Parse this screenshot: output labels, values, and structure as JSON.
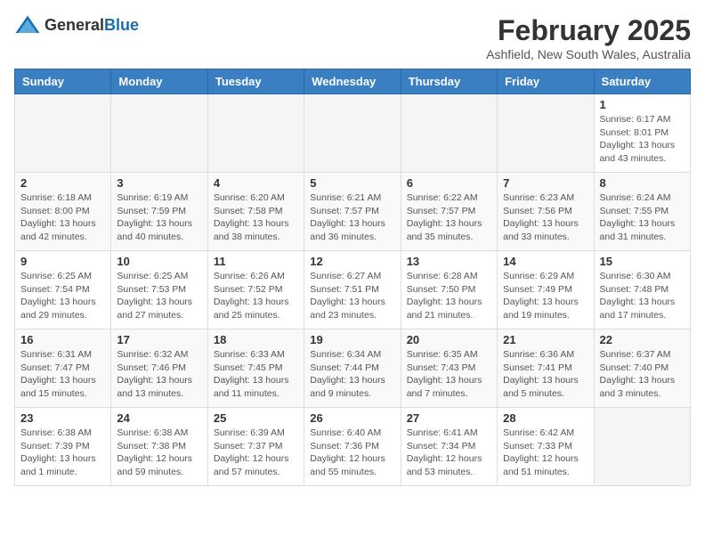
{
  "header": {
    "logo_general": "General",
    "logo_blue": "Blue",
    "title": "February 2025",
    "subtitle": "Ashfield, New South Wales, Australia"
  },
  "days_of_week": [
    "Sunday",
    "Monday",
    "Tuesday",
    "Wednesday",
    "Thursday",
    "Friday",
    "Saturday"
  ],
  "weeks": [
    [
      {
        "day": "",
        "info": ""
      },
      {
        "day": "",
        "info": ""
      },
      {
        "day": "",
        "info": ""
      },
      {
        "day": "",
        "info": ""
      },
      {
        "day": "",
        "info": ""
      },
      {
        "day": "",
        "info": ""
      },
      {
        "day": "1",
        "info": "Sunrise: 6:17 AM\nSunset: 8:01 PM\nDaylight: 13 hours and 43 minutes."
      }
    ],
    [
      {
        "day": "2",
        "info": "Sunrise: 6:18 AM\nSunset: 8:00 PM\nDaylight: 13 hours and 42 minutes."
      },
      {
        "day": "3",
        "info": "Sunrise: 6:19 AM\nSunset: 7:59 PM\nDaylight: 13 hours and 40 minutes."
      },
      {
        "day": "4",
        "info": "Sunrise: 6:20 AM\nSunset: 7:58 PM\nDaylight: 13 hours and 38 minutes."
      },
      {
        "day": "5",
        "info": "Sunrise: 6:21 AM\nSunset: 7:57 PM\nDaylight: 13 hours and 36 minutes."
      },
      {
        "day": "6",
        "info": "Sunrise: 6:22 AM\nSunset: 7:57 PM\nDaylight: 13 hours and 35 minutes."
      },
      {
        "day": "7",
        "info": "Sunrise: 6:23 AM\nSunset: 7:56 PM\nDaylight: 13 hours and 33 minutes."
      },
      {
        "day": "8",
        "info": "Sunrise: 6:24 AM\nSunset: 7:55 PM\nDaylight: 13 hours and 31 minutes."
      }
    ],
    [
      {
        "day": "9",
        "info": "Sunrise: 6:25 AM\nSunset: 7:54 PM\nDaylight: 13 hours and 29 minutes."
      },
      {
        "day": "10",
        "info": "Sunrise: 6:25 AM\nSunset: 7:53 PM\nDaylight: 13 hours and 27 minutes."
      },
      {
        "day": "11",
        "info": "Sunrise: 6:26 AM\nSunset: 7:52 PM\nDaylight: 13 hours and 25 minutes."
      },
      {
        "day": "12",
        "info": "Sunrise: 6:27 AM\nSunset: 7:51 PM\nDaylight: 13 hours and 23 minutes."
      },
      {
        "day": "13",
        "info": "Sunrise: 6:28 AM\nSunset: 7:50 PM\nDaylight: 13 hours and 21 minutes."
      },
      {
        "day": "14",
        "info": "Sunrise: 6:29 AM\nSunset: 7:49 PM\nDaylight: 13 hours and 19 minutes."
      },
      {
        "day": "15",
        "info": "Sunrise: 6:30 AM\nSunset: 7:48 PM\nDaylight: 13 hours and 17 minutes."
      }
    ],
    [
      {
        "day": "16",
        "info": "Sunrise: 6:31 AM\nSunset: 7:47 PM\nDaylight: 13 hours and 15 minutes."
      },
      {
        "day": "17",
        "info": "Sunrise: 6:32 AM\nSunset: 7:46 PM\nDaylight: 13 hours and 13 minutes."
      },
      {
        "day": "18",
        "info": "Sunrise: 6:33 AM\nSunset: 7:45 PM\nDaylight: 13 hours and 11 minutes."
      },
      {
        "day": "19",
        "info": "Sunrise: 6:34 AM\nSunset: 7:44 PM\nDaylight: 13 hours and 9 minutes."
      },
      {
        "day": "20",
        "info": "Sunrise: 6:35 AM\nSunset: 7:43 PM\nDaylight: 13 hours and 7 minutes."
      },
      {
        "day": "21",
        "info": "Sunrise: 6:36 AM\nSunset: 7:41 PM\nDaylight: 13 hours and 5 minutes."
      },
      {
        "day": "22",
        "info": "Sunrise: 6:37 AM\nSunset: 7:40 PM\nDaylight: 13 hours and 3 minutes."
      }
    ],
    [
      {
        "day": "23",
        "info": "Sunrise: 6:38 AM\nSunset: 7:39 PM\nDaylight: 13 hours and 1 minute."
      },
      {
        "day": "24",
        "info": "Sunrise: 6:38 AM\nSunset: 7:38 PM\nDaylight: 12 hours and 59 minutes."
      },
      {
        "day": "25",
        "info": "Sunrise: 6:39 AM\nSunset: 7:37 PM\nDaylight: 12 hours and 57 minutes."
      },
      {
        "day": "26",
        "info": "Sunrise: 6:40 AM\nSunset: 7:36 PM\nDaylight: 12 hours and 55 minutes."
      },
      {
        "day": "27",
        "info": "Sunrise: 6:41 AM\nSunset: 7:34 PM\nDaylight: 12 hours and 53 minutes."
      },
      {
        "day": "28",
        "info": "Sunrise: 6:42 AM\nSunset: 7:33 PM\nDaylight: 12 hours and 51 minutes."
      },
      {
        "day": "",
        "info": ""
      }
    ]
  ]
}
